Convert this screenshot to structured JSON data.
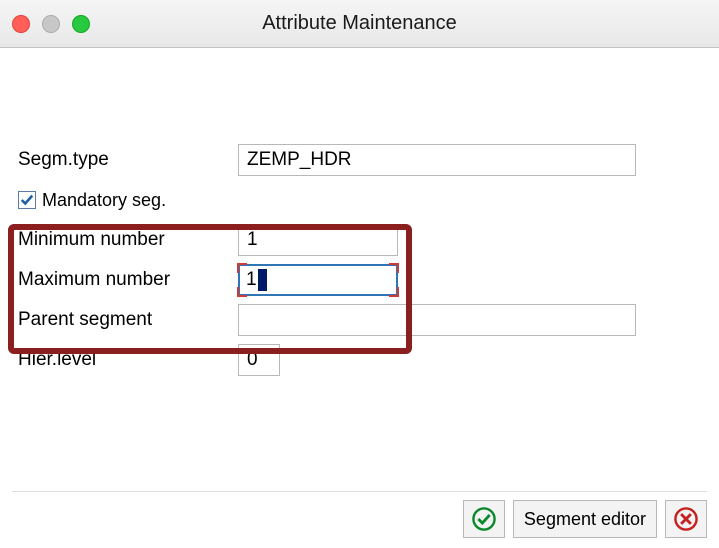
{
  "window": {
    "title": "Attribute Maintenance"
  },
  "form": {
    "segm_type_label": "Segm.type",
    "segm_type_value": "ZEMP_HDR",
    "mandatory_label": "Mandatory seg.",
    "mandatory_checked": true,
    "min_number_label": "Minimum number",
    "min_number_value": "1",
    "max_number_label": "Maximum number",
    "max_number_value": "1",
    "parent_segment_label": "Parent segment",
    "parent_segment_value": "",
    "hier_level_label": "Hier.level",
    "hier_level_value": "0"
  },
  "footer": {
    "confirm_label": "",
    "segment_editor_label": "Segment editor",
    "cancel_label": ""
  }
}
